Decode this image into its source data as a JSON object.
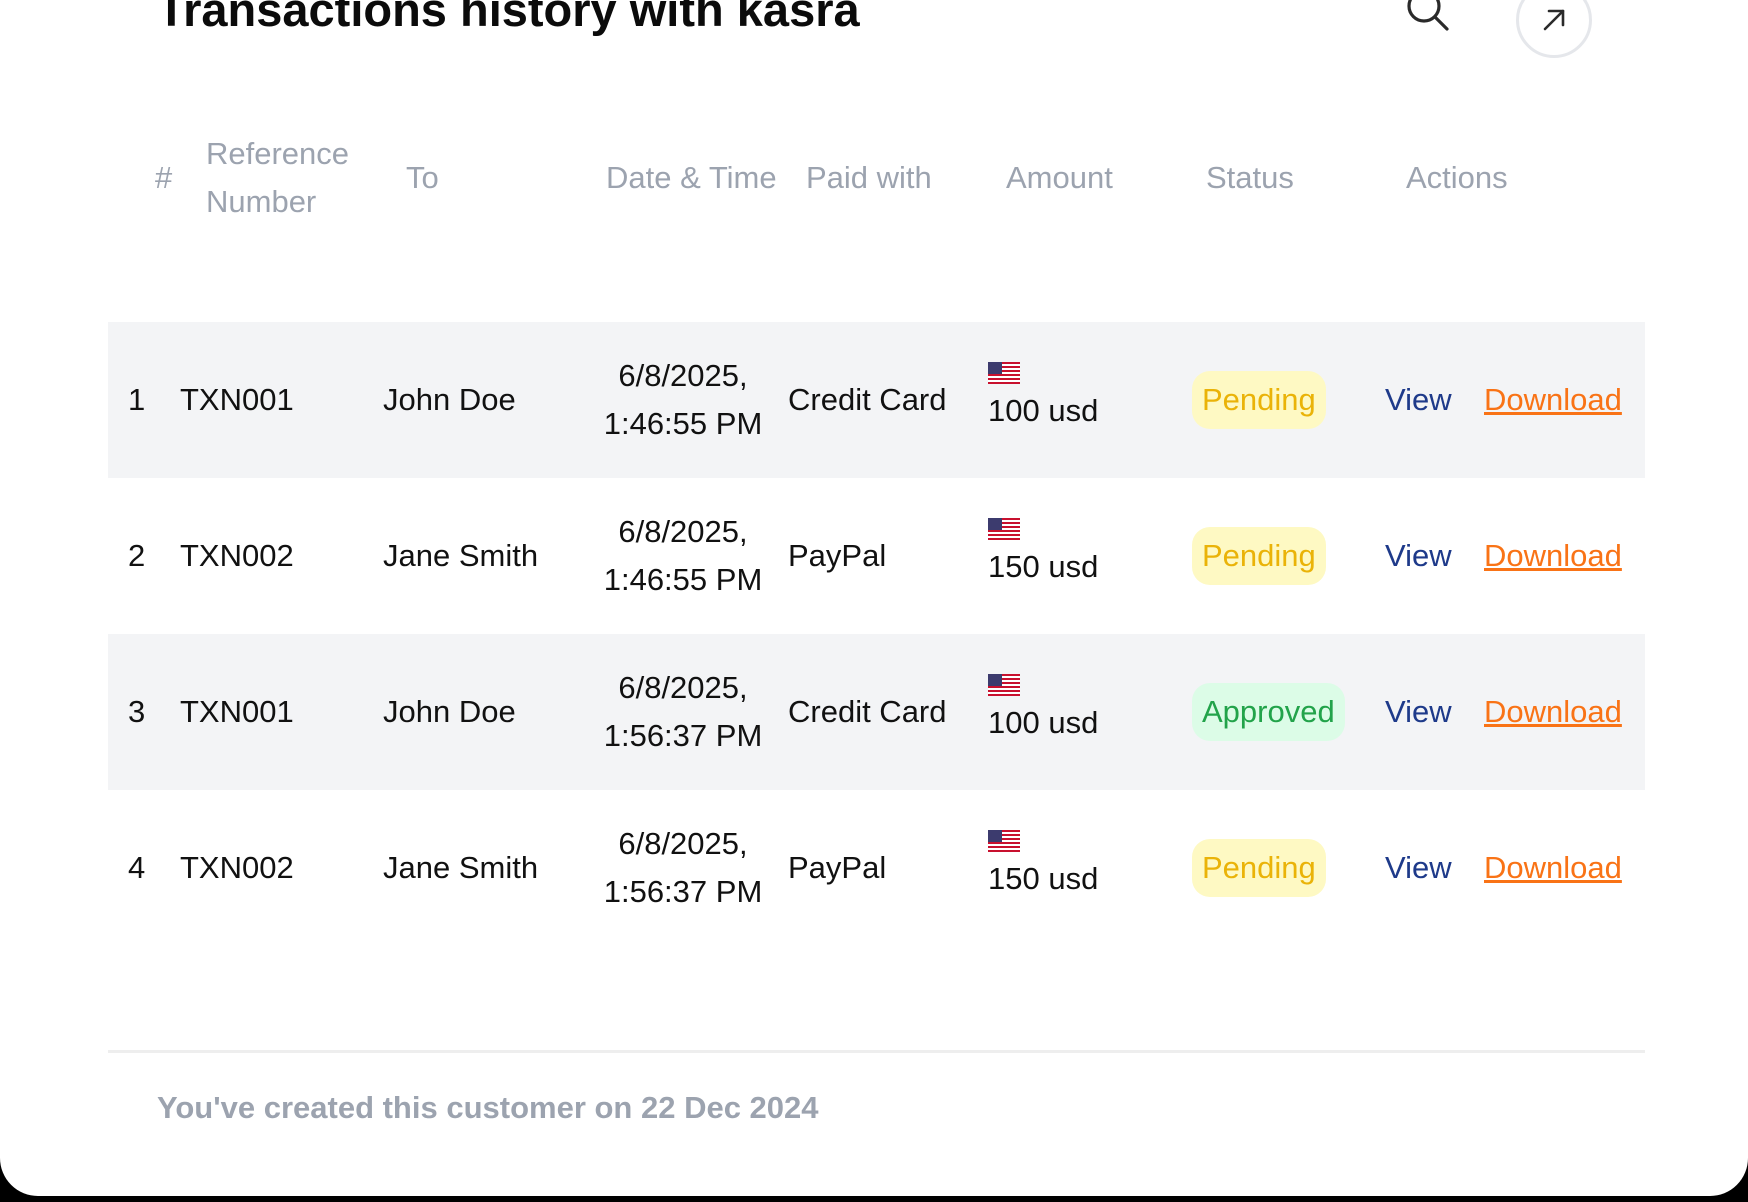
{
  "header": {
    "title": "Transactions history with kasra"
  },
  "table": {
    "columns": {
      "index": "#",
      "reference_line1": "Reference",
      "reference_line2": "Number",
      "to": "To",
      "datetime": "Date & Time",
      "paid_with": "Paid with",
      "amount": "Amount",
      "status": "Status",
      "actions": "Actions"
    },
    "rows": [
      {
        "index": "1",
        "reference": "TXN001",
        "to": "John Doe",
        "date": "6/8/2025,",
        "time": "1:46:55 PM",
        "paid_with": "Credit Card",
        "amount": "100 usd",
        "status": "Pending",
        "view": "View",
        "download": "Download"
      },
      {
        "index": "2",
        "reference": "TXN002",
        "to": "Jane Smith",
        "date": "6/8/2025,",
        "time": "1:46:55 PM",
        "paid_with": "PayPal",
        "amount": "150 usd",
        "status": "Pending",
        "view": "View",
        "download": "Download"
      },
      {
        "index": "3",
        "reference": "TXN001",
        "to": "John Doe",
        "date": "6/8/2025,",
        "time": "1:56:37 PM",
        "paid_with": "Credit Card",
        "amount": "100 usd",
        "status": "Approved",
        "view": "View",
        "download": "Download"
      },
      {
        "index": "4",
        "reference": "TXN002",
        "to": "Jane Smith",
        "date": "6/8/2025,",
        "time": "1:56:37 PM",
        "paid_with": "PayPal",
        "amount": "150 usd",
        "status": "Pending",
        "view": "View",
        "download": "Download"
      }
    ]
  },
  "footer": {
    "note": "You've created this customer on 22 Dec 2024"
  },
  "icons": {
    "search": "search-icon",
    "expand": "arrow-up-right-icon",
    "currency_flag": "us-flag-icon"
  },
  "colors": {
    "pending_bg": "#fef9c3",
    "pending_text": "#eab308",
    "approved_bg": "#dcfce7",
    "approved_text": "#22a34a",
    "view_link": "#1e3a8a",
    "download_link": "#f97316",
    "row_stripe": "#f3f4f6"
  }
}
